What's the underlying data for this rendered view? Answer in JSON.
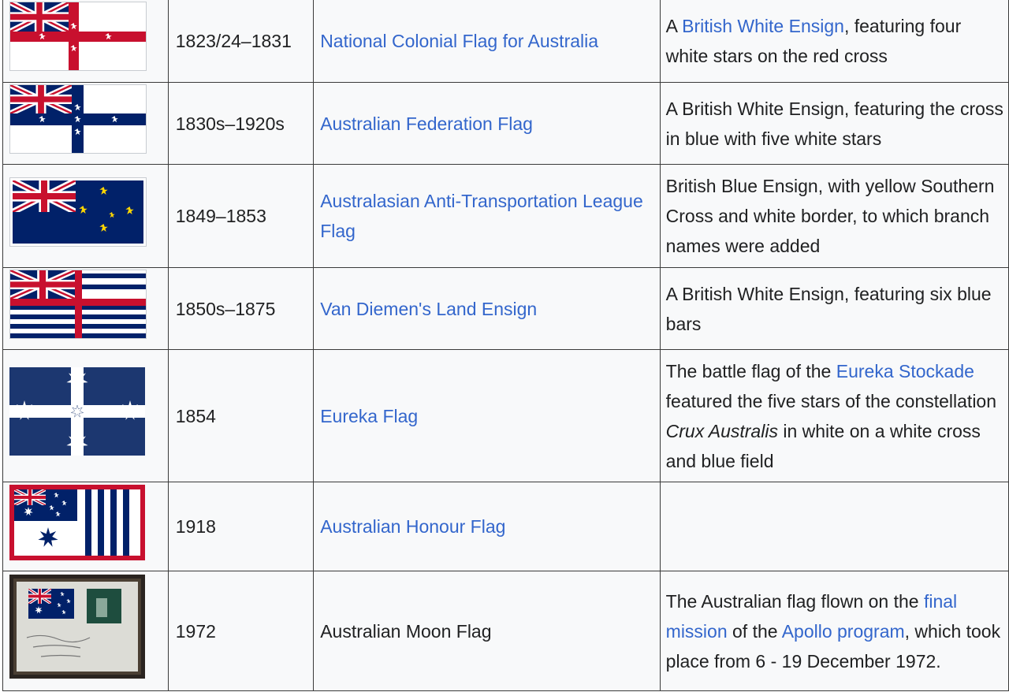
{
  "rows": [
    {
      "year": "1823/24–1831",
      "name": "National Colonial Flag for Australia",
      "name_is_link": true,
      "desc_parts": [
        {
          "text": "A ",
          "link": false
        },
        {
          "text": "British White Ensign",
          "link": true
        },
        {
          "text": ", featuring four white stars on the red cross",
          "link": false
        }
      ]
    },
    {
      "year": "1830s–1920s",
      "name": "Australian Federation Flag",
      "name_is_link": true,
      "desc_parts": [
        {
          "text": "A British White Ensign, featuring the cross in blue with five white stars",
          "link": false
        }
      ]
    },
    {
      "year": "1849–1853",
      "name": "Australasian Anti-Transportation League Flag",
      "name_is_link": true,
      "desc_parts": [
        {
          "text": "British Blue Ensign, with yellow Southern Cross and white border, to which branch names were added",
          "link": false
        }
      ]
    },
    {
      "year": "1850s–1875",
      "name": "Van Diemen's Land Ensign",
      "name_is_link": true,
      "desc_parts": [
        {
          "text": "A British White Ensign, featuring six blue bars",
          "link": false
        }
      ]
    },
    {
      "year": "1854",
      "name": "Eureka Flag",
      "name_is_link": true,
      "desc_parts": [
        {
          "text": "The battle flag of the ",
          "link": false
        },
        {
          "text": "Eureka Stockade",
          "link": true
        },
        {
          "text": " featured the five stars of the constellation ",
          "link": false
        },
        {
          "text": "Crux Australis",
          "link": false,
          "italic": true
        },
        {
          "text": " in white on a white cross and blue field",
          "link": false
        }
      ]
    },
    {
      "year": "1918",
      "name": "Australian Honour Flag",
      "name_is_link": true,
      "desc_parts": []
    },
    {
      "year": "1972",
      "name": "Australian Moon Flag",
      "name_is_link": false,
      "desc_parts": [
        {
          "text": "The Australian flag flown on the ",
          "link": false
        },
        {
          "text": "final mission",
          "link": true
        },
        {
          "text": " of the ",
          "link": false
        },
        {
          "text": "Apollo program",
          "link": true
        },
        {
          "text": ", which took place from 6 - 19 December 1972.",
          "link": false
        }
      ]
    }
  ],
  "colors": {
    "link": "#3366cc",
    "text": "#202122",
    "cell_bg": "#f8f9fa",
    "border": "#3a3a3a",
    "flag_red": "#c8102e",
    "flag_blue": "#012169",
    "star_yellow": "#ffd700"
  }
}
